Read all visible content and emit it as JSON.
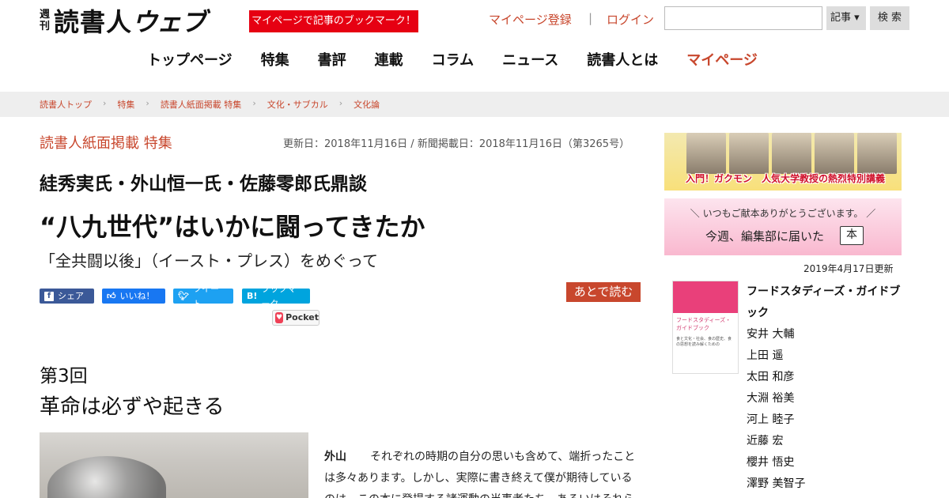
{
  "header": {
    "logo_small": "週刊",
    "logo_main": "読書人",
    "logo_web": "ウェブ",
    "mypage_banner": "マイページで記事のブックマーク！",
    "register_link": "マイページ登録",
    "separator": "|",
    "login_link": "ログイン",
    "search": {
      "select_label": "記事 ▾",
      "button_label": "検 索"
    }
  },
  "nav": {
    "items": [
      "トップページ",
      "特集",
      "書評",
      "連載",
      "コラム",
      "ニュース",
      "読書人とは",
      "マイページ"
    ]
  },
  "breadcrumb": [
    "読書人トップ",
    "特集",
    "読書人紙面掲載 特集",
    "文化・サブカル",
    "文化論"
  ],
  "article": {
    "category": "読書人紙面掲載 特集",
    "dates": "更新日：2018年11月16日 / 新聞掲載日：2018年11月16日（第3265号）",
    "speakers": "絓秀実氏・外山恒一氏・佐藤零郎氏鼎談",
    "title": "“八九世代”はいかに闘ってきたか",
    "subtitle": "「全共闘以後」（イースト・プレス）をめぐって",
    "share": {
      "facebook": "シェア",
      "like": "いいね！",
      "tweet": "ツイート",
      "hatena": "ブックマーク",
      "hatena_mark": "B!",
      "pocket": "Pocket"
    },
    "read_later": "あとで読む",
    "chapter": "第3回",
    "chapter_title": "革命は必ずや起きる",
    "speaker_tag": "外山",
    "body_lines": [
      "それぞれの時期の自分の思いも含めて、端折ったこと",
      "は多々あります。しかし、実際に書き終えて僕が期待している",
      "のは、この本に登場する諸運動の当事者たち、あるいはそれら"
    ]
  },
  "sidebar": {
    "ad1_text": "入門！ガクモン　人気大学教授の熱烈特別講義",
    "ad2_line1": "＼ いつもご献本ありがとうございます。 ／",
    "ad2_line2": "今週、編集部に届いた",
    "ad2_book": "本",
    "updated": "2019年4月17日更新",
    "book": {
      "cover_title": "フードスタディーズ・ガイドブック",
      "cover_note": "食と文化・社会、食の歴史、食の思想を読み解くための",
      "title": "フードスタディーズ・ガイドブック",
      "authors": [
        "安井 大輔",
        "上田 遥",
        "太田 和彦",
        "大淵 裕美",
        "河上 睦子",
        "近藤 宏",
        "櫻井 悟史",
        "澤野 美智子"
      ]
    }
  },
  "colors": {
    "accent": "#c8472d",
    "banner_red": "#e60012",
    "facebook": "#3b5998",
    "like": "#1877f2",
    "twitter": "#1da1f2",
    "hatena": "#00a4de"
  }
}
